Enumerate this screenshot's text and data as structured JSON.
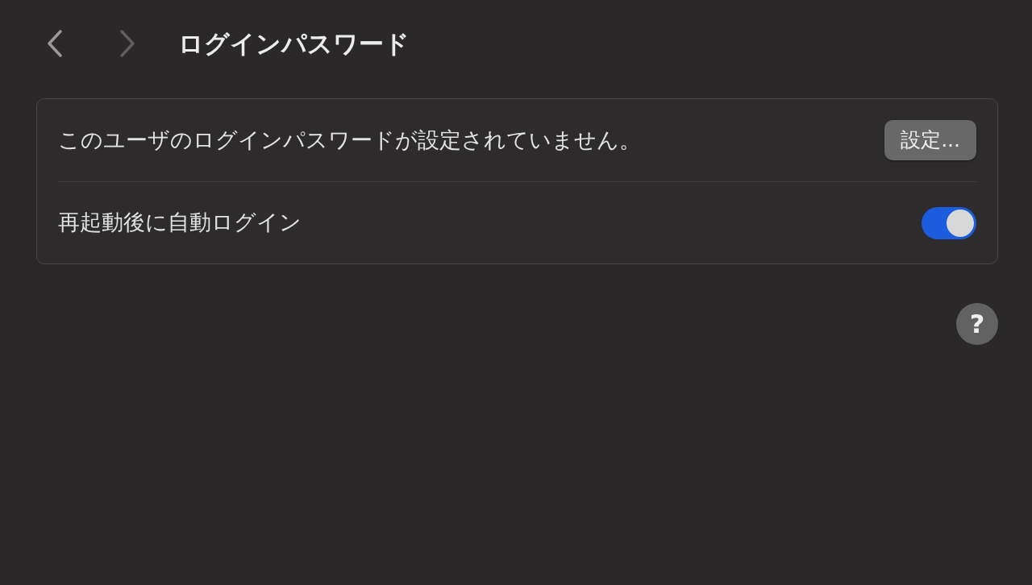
{
  "toolbar": {
    "back": {
      "disabled": false
    },
    "forward": {
      "disabled": true
    },
    "title": "ログインパスワード"
  },
  "rows": [
    {
      "kind": "button",
      "label": "このユーザのログインパスワードが設定されていません。",
      "button": "設定..."
    },
    {
      "kind": "toggle",
      "label": "再起動後に自動ログイン",
      "on": true
    }
  ],
  "help": "?"
}
